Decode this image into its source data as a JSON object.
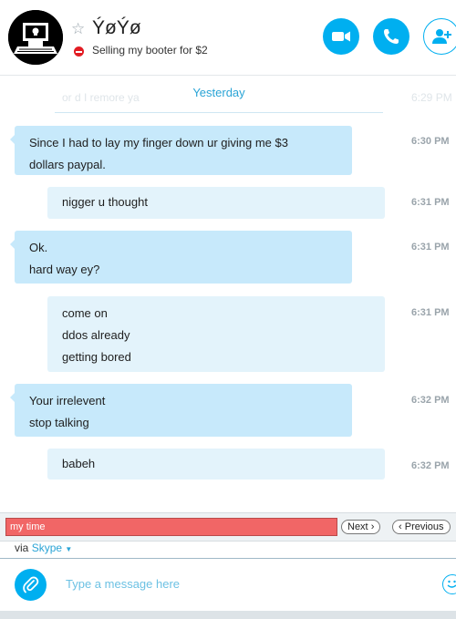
{
  "contact": {
    "name": "ÝøÝø",
    "mood": "Selling my booter for $2"
  },
  "conversation": {
    "faded_text": "or d I remore ya",
    "faded_time": "6:29 PM",
    "date_separator": "Yesterday",
    "messages": [
      {
        "lines": [
          "Since I had to lay my finger down ur giving me $3",
          "dollars paypal."
        ],
        "time": "6:30 PM"
      },
      {
        "lines": [
          "nigger u thought"
        ],
        "time": "6:31 PM"
      },
      {
        "lines": [
          "Ok.",
          "hard way ey?"
        ],
        "time": "6:31 PM"
      },
      {
        "lines": [
          "come on",
          "ddos already",
          "getting bored"
        ],
        "time": "6:31 PM"
      },
      {
        "lines": [
          "Your irrelevent",
          "stop talking"
        ],
        "time": "6:32 PM"
      },
      {
        "lines": [
          "babeh"
        ],
        "time": "6:32 PM"
      }
    ]
  },
  "find_bar": {
    "value": "my time",
    "next_label": "Next",
    "previous_label": "Previous"
  },
  "via": {
    "prefix": "via",
    "service": "Skype"
  },
  "composer": {
    "placeholder": "Type a message here"
  },
  "colors": {
    "accent": "#00aff0",
    "incoming_bubble": "#c7e9fb",
    "outgoing_bubble": "#e3f3fb",
    "find_highlight": "#f16666",
    "status_dnd": "#e21c23"
  },
  "icons": [
    "avatar-image",
    "favorite-star-icon",
    "do-not-disturb-icon",
    "video-call-icon",
    "phone-icon",
    "add-person-icon",
    "paperclip-icon",
    "emoticon-icon"
  ]
}
